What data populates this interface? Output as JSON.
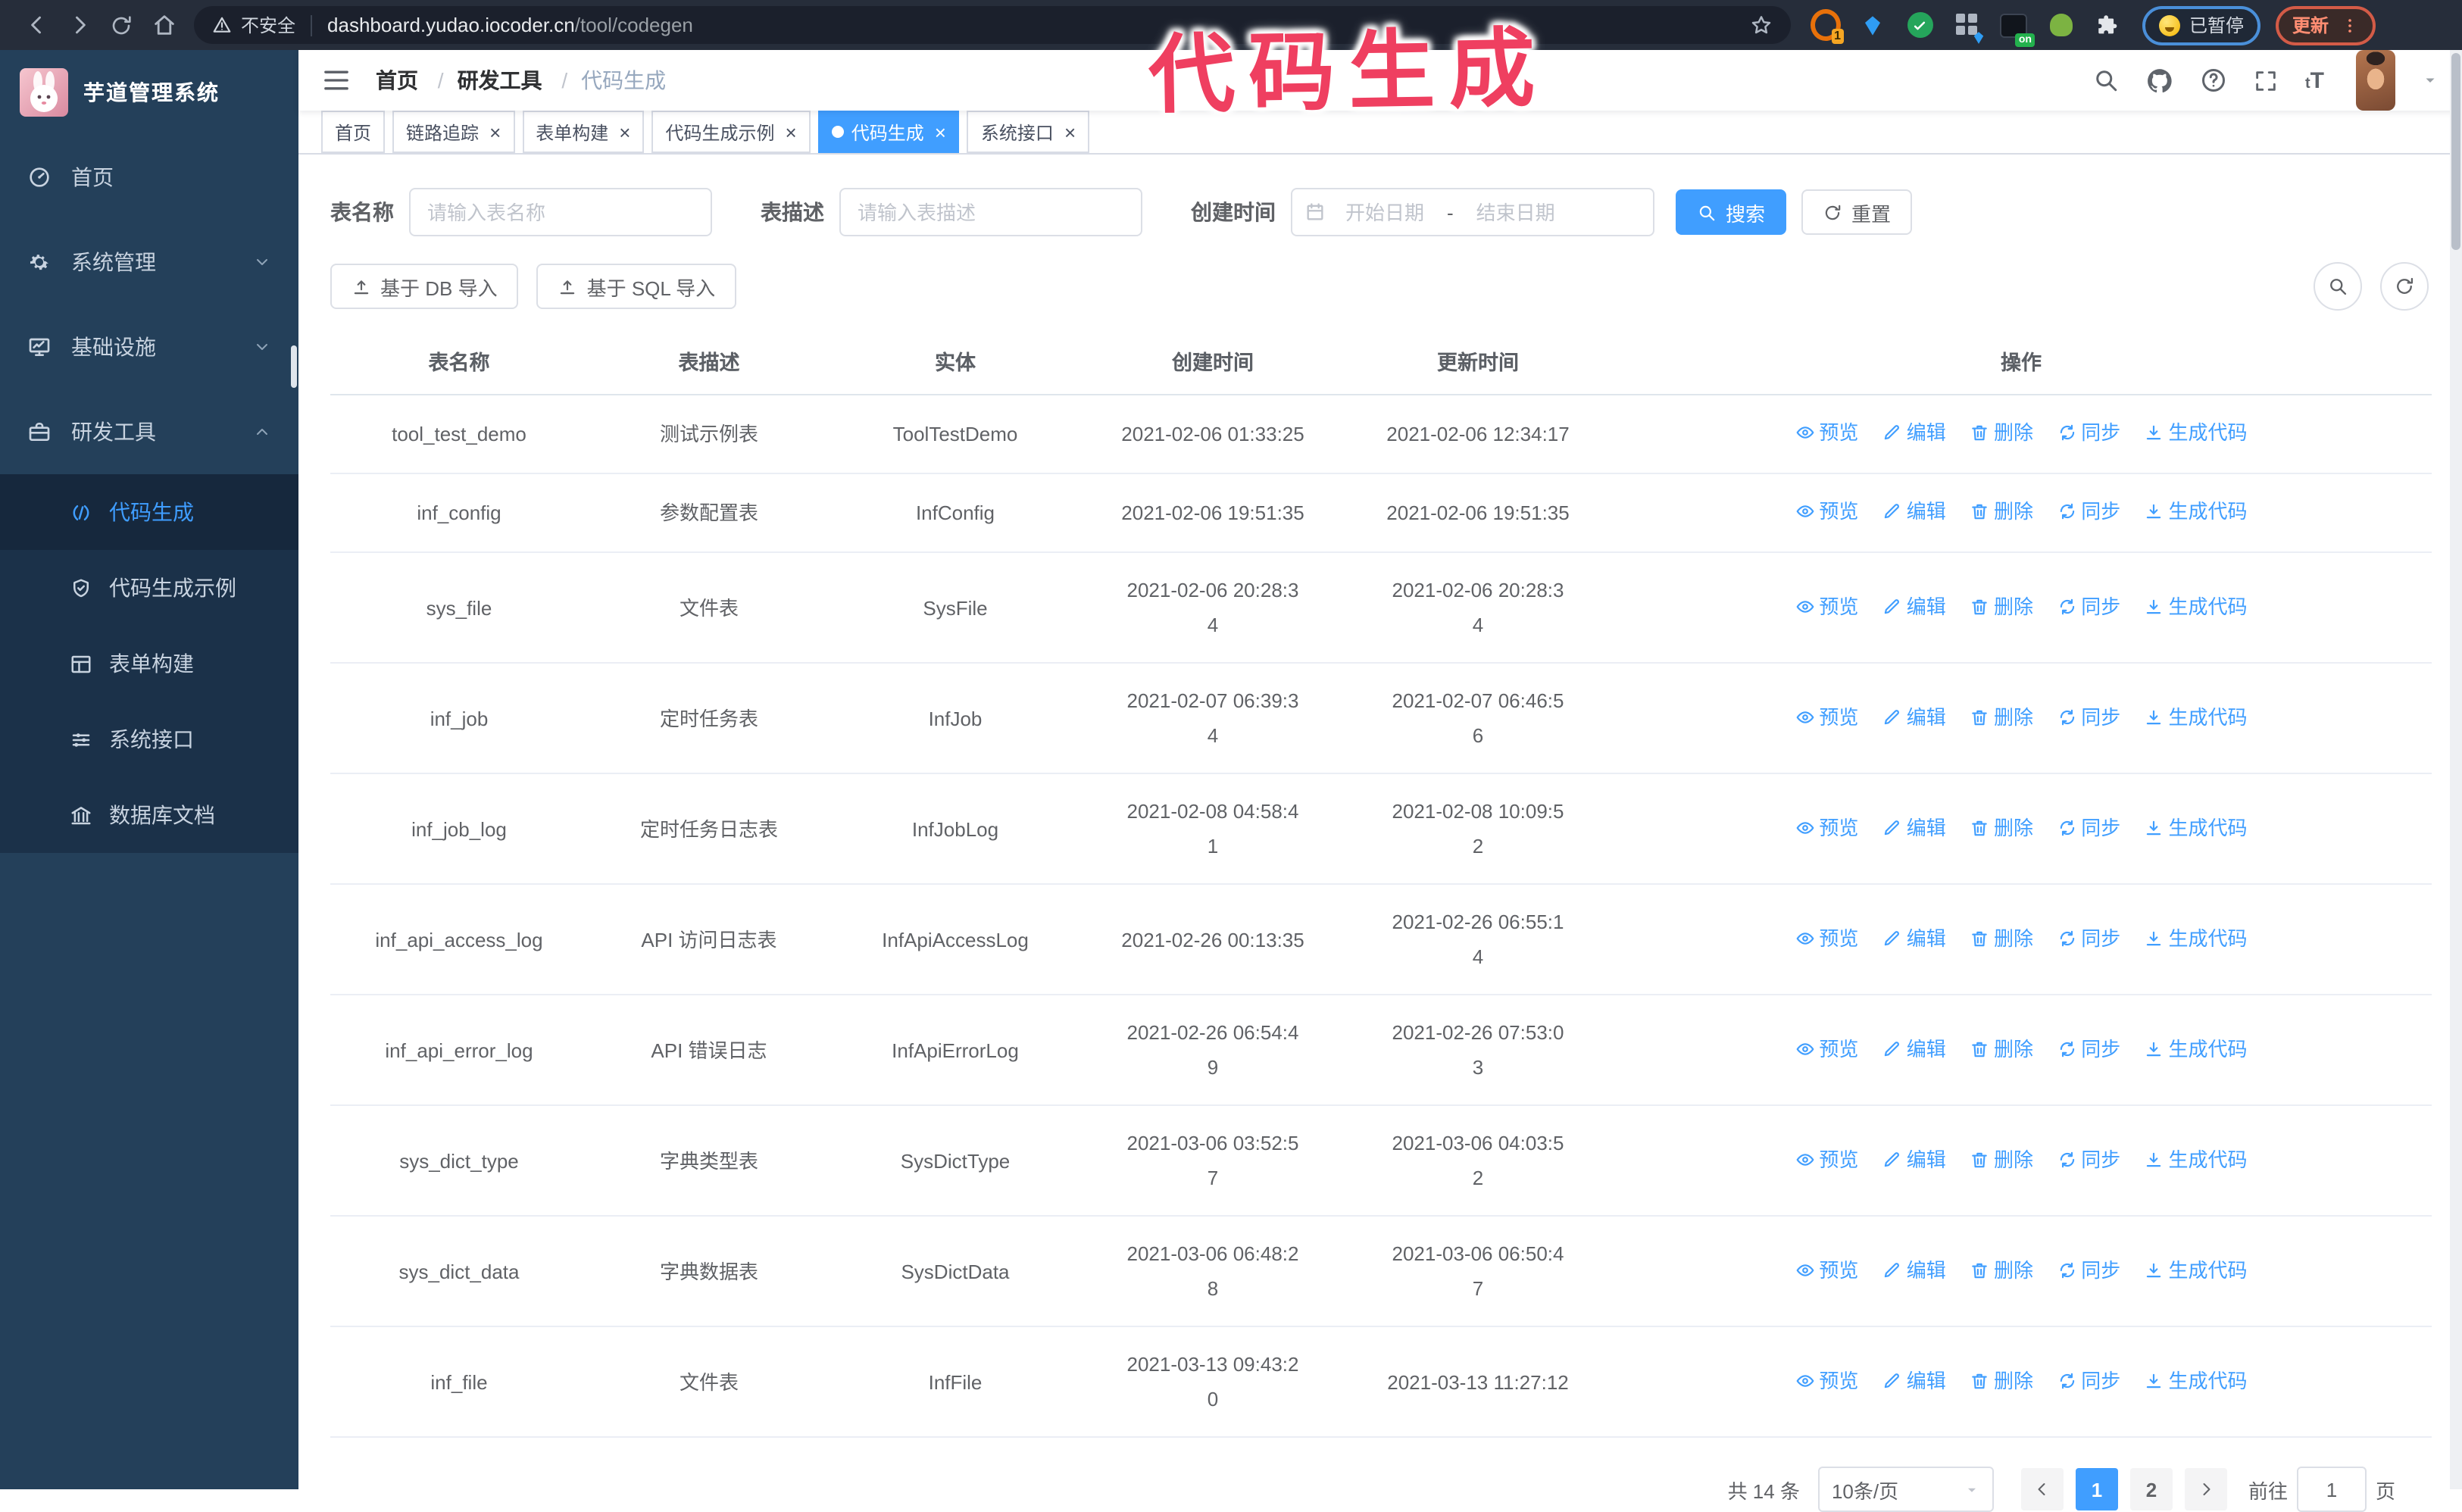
{
  "colors": {
    "accent": "#409eff",
    "sidebar_bg": "#24405a",
    "submenu_bg": "#1b3149",
    "annotation_pink": "#ef3f60",
    "active_tab_bg": "#409eff"
  },
  "annotation": {
    "text": "代码生成"
  },
  "browser": {
    "security_label": "不安全",
    "url_host": "dashboard.yudao.iocoder.cn",
    "url_path": "/tool/codegen",
    "extension_badge_1": "1",
    "extension_badge_on": "on",
    "paused_badge": "已暂停",
    "update_button": "更新"
  },
  "sidebar": {
    "app_title": "芋道管理系统",
    "menu": [
      {
        "label": "首页",
        "icon": "i-dash"
      },
      {
        "label": "系统管理",
        "icon": "i-gear",
        "chevron": "i-chev-down"
      },
      {
        "label": "基础设施",
        "icon": "i-monitor",
        "chevron": "i-chev-down"
      },
      {
        "label": "研发工具",
        "icon": "i-toolbox",
        "chevron": "i-chev-up",
        "active": true
      }
    ],
    "submenu": [
      {
        "label": "代码生成",
        "icon": "i-code",
        "active": true
      },
      {
        "label": "代码生成示例",
        "icon": "i-shield"
      },
      {
        "label": "表单构建",
        "icon": "i-form"
      },
      {
        "label": "系统接口",
        "icon": "i-sliders"
      },
      {
        "label": "数据库文档",
        "icon": "i-db"
      }
    ]
  },
  "navbar": {
    "separator": "/",
    "breadcrumb": [
      {
        "label": "首页",
        "sep": true
      },
      {
        "label": "研发工具",
        "sep": true
      },
      {
        "label": "代码生成",
        "last": true
      }
    ],
    "font_size_icon_label": "tT"
  },
  "tabs": [
    {
      "label": "首页",
      "closable": false
    },
    {
      "label": "链路追踪",
      "closable": true
    },
    {
      "label": "表单构建",
      "closable": true
    },
    {
      "label": "代码生成示例",
      "closable": true
    },
    {
      "label": "代码生成",
      "closable": true,
      "active": true
    },
    {
      "label": "系统接口",
      "closable": true
    }
  ],
  "filters": {
    "table_name_label": "表名称",
    "table_name_placeholder": "请输入表名称",
    "table_desc_label": "表描述",
    "table_desc_placeholder": "请输入表描述",
    "create_time_label": "创建时间",
    "date_start_placeholder": "开始日期",
    "date_separator": "-",
    "date_end_placeholder": "结束日期",
    "search_label": "搜索",
    "reset_label": "重置"
  },
  "toolbar": {
    "import_db_label": "基于 DB 导入",
    "import_sql_label": "基于 SQL 导入"
  },
  "table": {
    "columns": [
      "表名称",
      "表描述",
      "实体",
      "创建时间",
      "更新时间",
      "操作"
    ],
    "actions": [
      "预览",
      "编辑",
      "删除",
      "同步",
      "生成代码"
    ],
    "rows": [
      {
        "name": "tool_test_demo",
        "desc": "测试示例表",
        "entity": "ToolTestDemo",
        "created": [
          "2021-02-06 01:33:25"
        ],
        "updated": [
          "2021-02-06 12:34:17"
        ]
      },
      {
        "name": "inf_config",
        "desc": "参数配置表",
        "entity": "InfConfig",
        "created": [
          "2021-02-06 19:51:35"
        ],
        "updated": [
          "2021-02-06 19:51:35"
        ]
      },
      {
        "name": "sys_file",
        "desc": "文件表",
        "entity": "SysFile",
        "created": [
          "2021-02-06 20:28:3",
          "4"
        ],
        "updated": [
          "2021-02-06 20:28:3",
          "4"
        ]
      },
      {
        "name": "inf_job",
        "desc": "定时任务表",
        "entity": "InfJob",
        "created": [
          "2021-02-07 06:39:3",
          "4"
        ],
        "updated": [
          "2021-02-07 06:46:5",
          "6"
        ]
      },
      {
        "name": "inf_job_log",
        "desc": "定时任务日志表",
        "entity": "InfJobLog",
        "created": [
          "2021-02-08 04:58:4",
          "1"
        ],
        "updated": [
          "2021-02-08 10:09:5",
          "2"
        ]
      },
      {
        "name": "inf_api_access_log",
        "desc": "API 访问日志表",
        "entity": "InfApiAccessLog",
        "created": [
          "2021-02-26 00:13:35"
        ],
        "updated": [
          "2021-02-26 06:55:1",
          "4"
        ]
      },
      {
        "name": "inf_api_error_log",
        "desc": "API 错误日志",
        "entity": "InfApiErrorLog",
        "created": [
          "2021-02-26 06:54:4",
          "9"
        ],
        "updated": [
          "2021-02-26 07:53:0",
          "3"
        ]
      },
      {
        "name": "sys_dict_type",
        "desc": "字典类型表",
        "entity": "SysDictType",
        "created": [
          "2021-03-06 03:52:5",
          "7"
        ],
        "updated": [
          "2021-03-06 04:03:5",
          "2"
        ]
      },
      {
        "name": "sys_dict_data",
        "desc": "字典数据表",
        "entity": "SysDictData",
        "created": [
          "2021-03-06 06:48:2",
          "8"
        ],
        "updated": [
          "2021-03-06 06:50:4",
          "7"
        ]
      },
      {
        "name": "inf_file",
        "desc": "文件表",
        "entity": "InfFile",
        "created": [
          "2021-03-13 09:43:2",
          "0"
        ],
        "updated": [
          "2021-03-13 11:27:12"
        ]
      }
    ]
  },
  "pagination": {
    "total": "共 14 条",
    "page_size": "10条/页",
    "pages": [
      {
        "label": "1",
        "active": true
      },
      {
        "label": "2"
      }
    ],
    "goto_label": "前往",
    "goto_value": "1",
    "goto_suffix": "页"
  }
}
